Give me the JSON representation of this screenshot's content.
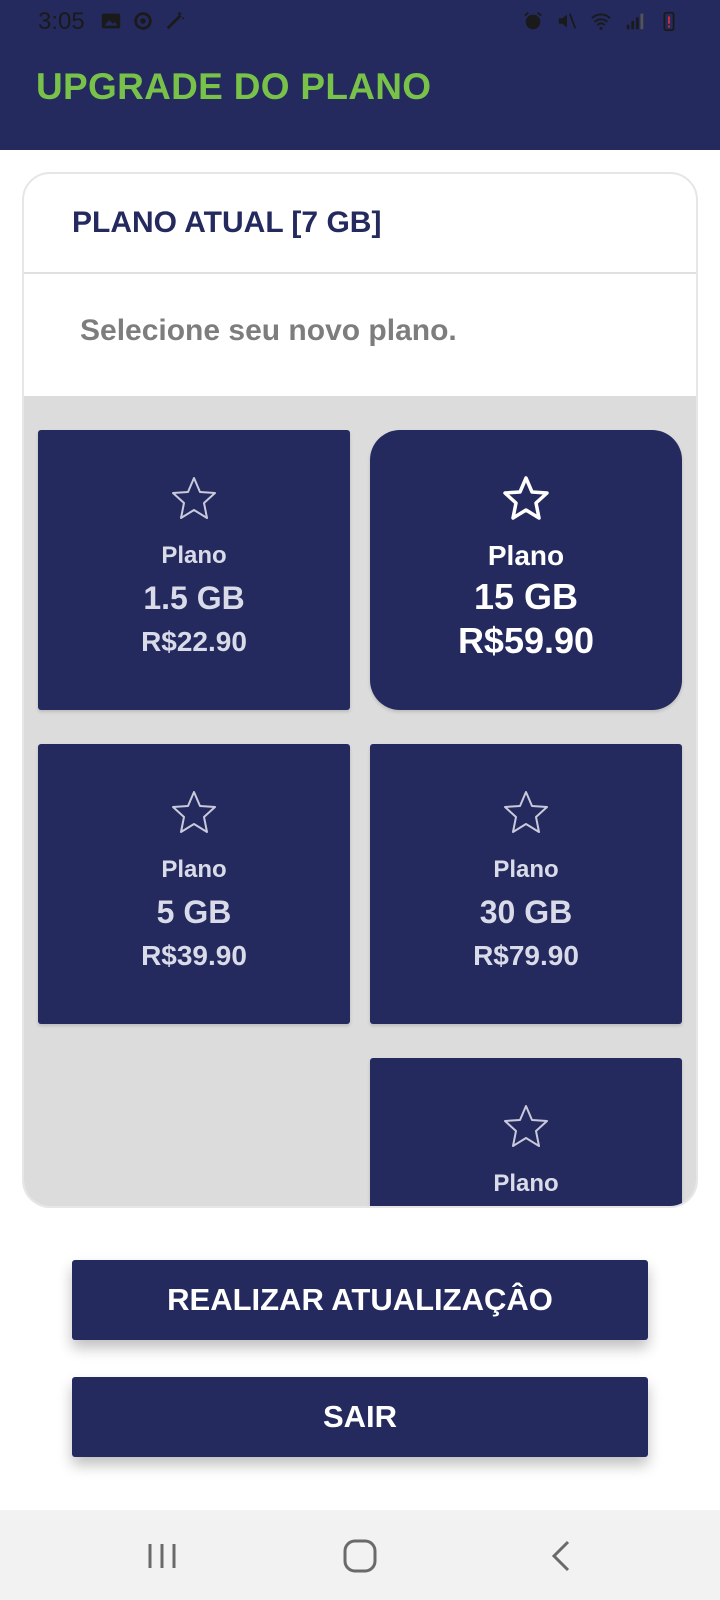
{
  "status_bar": {
    "time": "3:05",
    "left_icons": [
      "image-icon",
      "sync-icon",
      "magic-wand-icon"
    ],
    "right_icons": [
      "alarm-icon",
      "mute-icon",
      "wifi-icon",
      "signal-icon",
      "battery-alert-icon"
    ]
  },
  "app_bar": {
    "title": "UPGRADE DO PLANO",
    "title_color": "#79c24a",
    "background": "#242a5e"
  },
  "card": {
    "header_title": "PLANO ATUAL [7 GB]",
    "subtitle": "Selecione seu novo plano."
  },
  "plans": [
    {
      "label": "Plano",
      "size": "1.5 GB",
      "price": "R$22.90",
      "selected": false,
      "icon": "star-outline-icon"
    },
    {
      "label": "Plano",
      "size": "15 GB",
      "price": "R$59.90",
      "selected": true,
      "icon": "star-outline-icon"
    },
    {
      "label": "Plano",
      "size": "5 GB",
      "price": "R$39.90",
      "selected": false,
      "icon": "star-outline-icon"
    },
    {
      "label": "Plano",
      "size": "30 GB",
      "price": "R$79.90",
      "selected": false,
      "icon": "star-outline-icon"
    },
    {
      "label": "Plano",
      "size": "",
      "price": "",
      "selected": false,
      "icon": "star-outline-icon"
    }
  ],
  "buttons": {
    "update_label": "REALIZAR ATUALIZAÇÂO",
    "exit_label": "SAIR"
  },
  "nav_bar": {
    "icons": [
      "recent-apps-icon",
      "home-icon",
      "back-icon"
    ]
  },
  "colors": {
    "primary": "#242a5e",
    "accent": "#79c24a",
    "grid_background": "#dcdcdc"
  }
}
